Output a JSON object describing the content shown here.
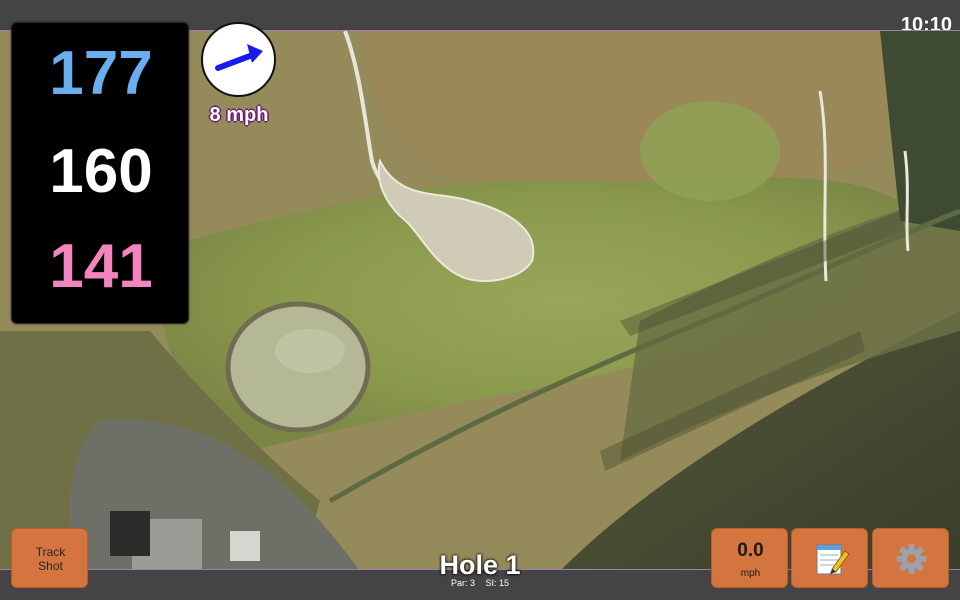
{
  "status_bar": {
    "time": "10:10"
  },
  "distances": {
    "back": "177",
    "middle": "160",
    "front": "141"
  },
  "wind": {
    "speed": "8 mph",
    "direction_icon": "arrow-up-right-icon"
  },
  "map": {
    "view": "satellite-hole-overview"
  },
  "buttons": {
    "track_shot": {
      "line1": "Track",
      "line2": "Shot"
    },
    "speed": {
      "value": "0.0",
      "unit": "mph"
    },
    "notes": {
      "icon": "notepad-pencil-icon"
    },
    "settings": {
      "icon": "gear-icon"
    }
  },
  "hole": {
    "title": "Hole 1",
    "par": "Par: 3",
    "si": "SI: 15"
  },
  "colors": {
    "back": "#6aaef0",
    "middle": "#ffffff",
    "front": "#f285bd",
    "button": "#d4743e",
    "wind_arrow": "#1a1aee",
    "wind_text_outline": "#6a1a70",
    "bars": "#444446"
  }
}
